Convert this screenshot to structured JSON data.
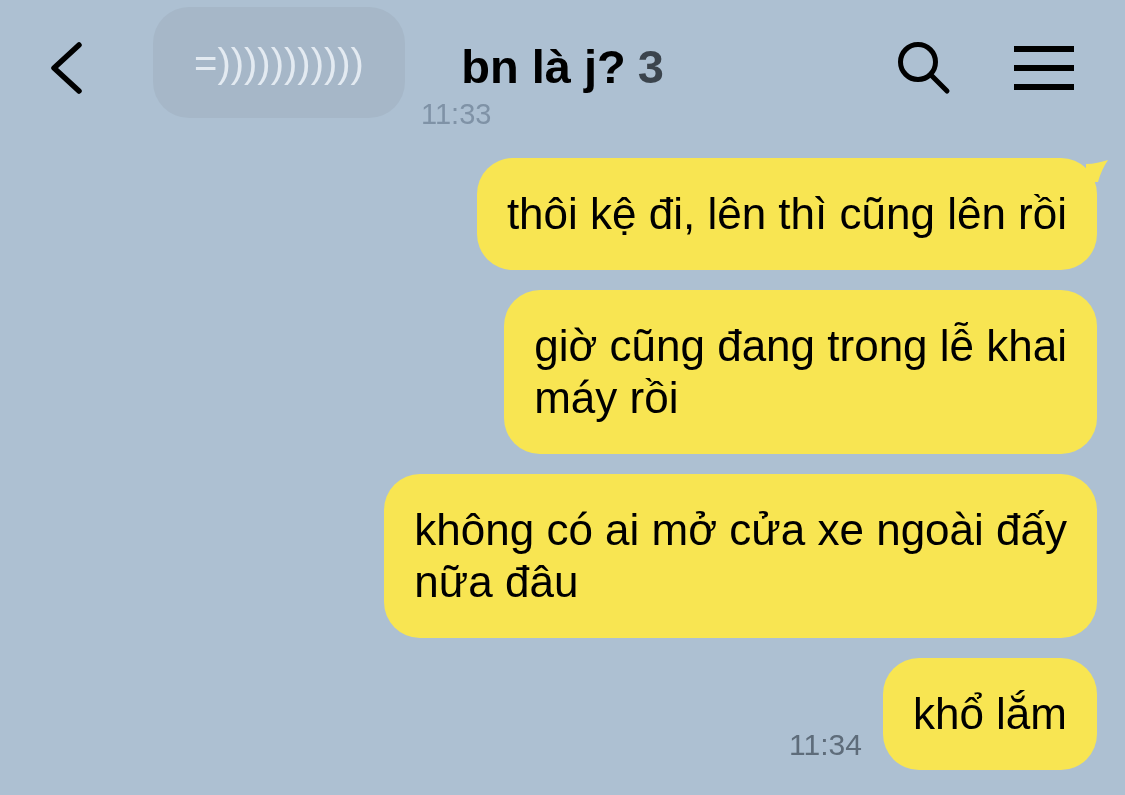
{
  "header": {
    "title": "bn là j?",
    "member_count": "3"
  },
  "scrolled_message": {
    "text": "=)))))))))))",
    "time": "11:33"
  },
  "messages": [
    {
      "text": "thôi kệ đi, lên thì cũng lên rồi",
      "tail": true
    },
    {
      "text": "giờ cũng đang trong lễ khai\nmáy rồi",
      "tail": false
    },
    {
      "text": "không có ai mở cửa xe ngoài đấy\nnữa đâu",
      "tail": false
    },
    {
      "text": "khổ lắm",
      "tail": false,
      "time": "11:34"
    }
  ]
}
